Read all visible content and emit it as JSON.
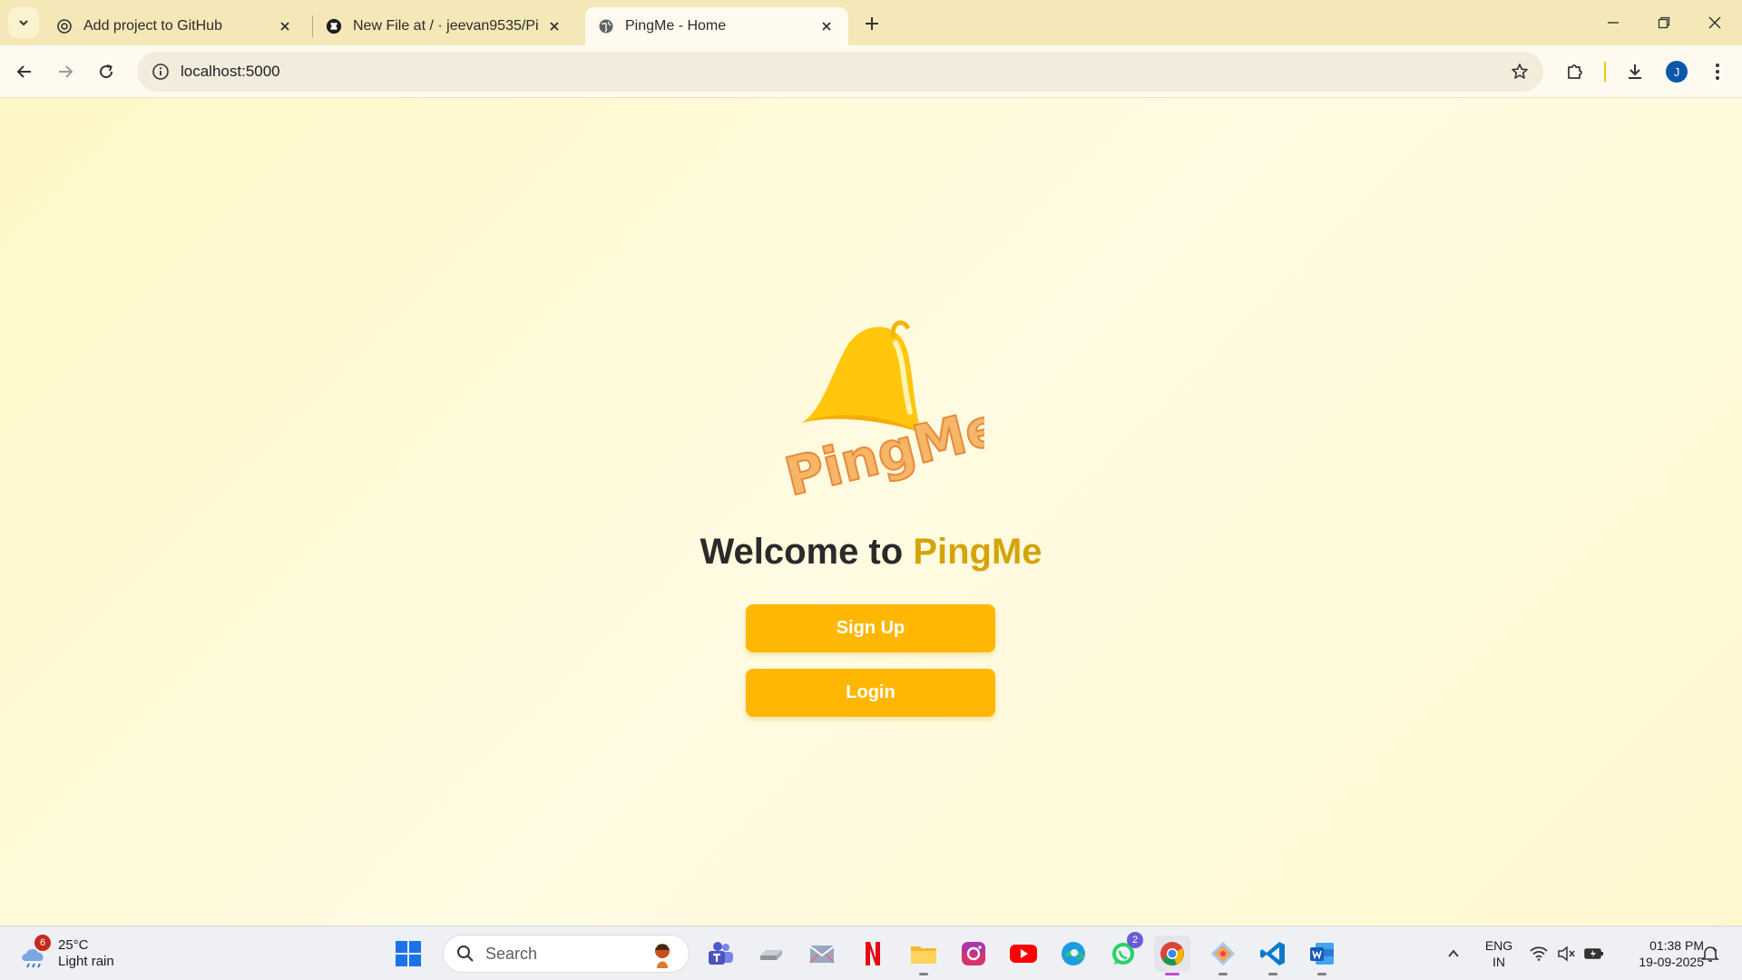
{
  "browser": {
    "tabs": [
      {
        "title": "Add project to GitHub",
        "favicon": "openai-icon"
      },
      {
        "title": "New File at / · jeevan9535/PingMe",
        "favicon": "github-icon"
      },
      {
        "title": "PingMe - Home",
        "favicon": "globe-icon",
        "active": true
      }
    ],
    "url": "localhost:5000",
    "profile_initial": "J"
  },
  "page": {
    "logo_text": "PingMe",
    "welcome_prefix": "Welcome to ",
    "welcome_brand": "PingMe",
    "signup_label": "Sign Up",
    "login_label": "Login",
    "colors": {
      "accent": "#ffb703",
      "brand_text": "#d4a408",
      "logo_text": "#f3a546",
      "bell": "#ffc60b"
    }
  },
  "taskbar": {
    "weather": {
      "temp": "25°C",
      "condition": "Light rain",
      "badge": "6"
    },
    "search_placeholder": "Search",
    "apps": [
      {
        "name": "teams-icon"
      },
      {
        "name": "drive-icon"
      },
      {
        "name": "mail-icon"
      },
      {
        "name": "netflix-icon"
      },
      {
        "name": "file-explorer-icon"
      },
      {
        "name": "instagram-icon"
      },
      {
        "name": "youtube-icon"
      },
      {
        "name": "edge-icon"
      },
      {
        "name": "whatsapp-icon",
        "badge": "2"
      },
      {
        "name": "chrome-icon"
      },
      {
        "name": "git-icon"
      },
      {
        "name": "vscode-icon"
      },
      {
        "name": "word-icon"
      }
    ],
    "lang_line1": "ENG",
    "lang_line2": "IN",
    "time": "01:38 PM",
    "date": "19-09-2025"
  }
}
